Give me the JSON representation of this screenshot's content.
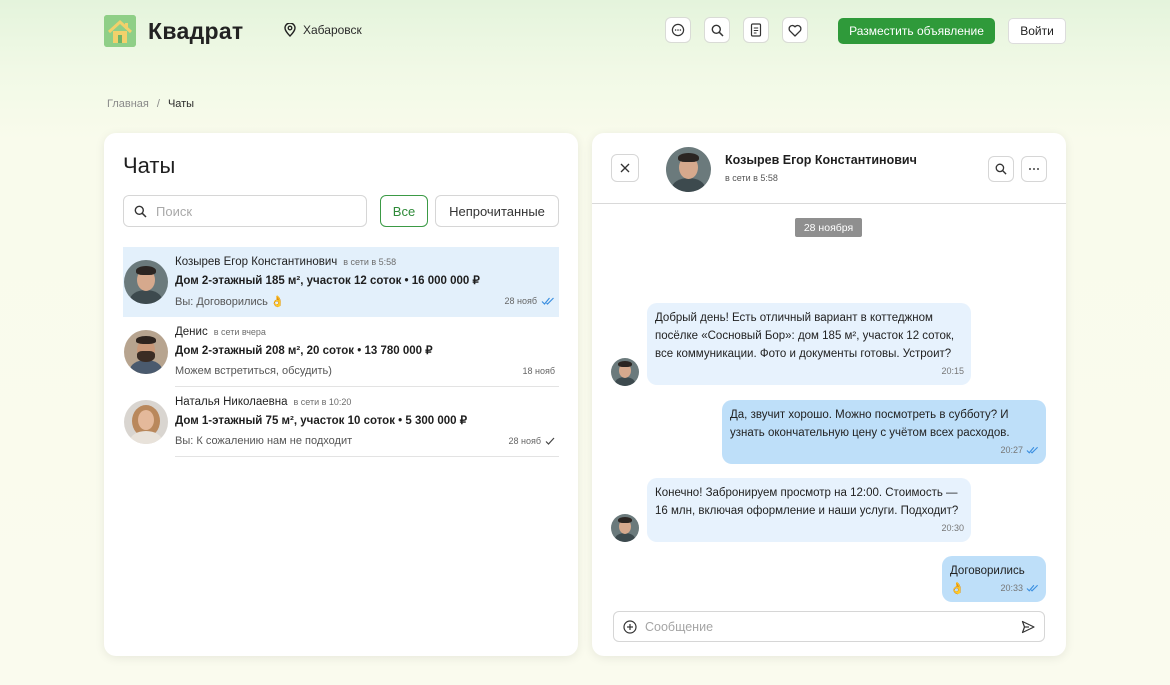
{
  "header": {
    "brand": "Квадрат",
    "city": "Хабаровск",
    "post_ad_label": "Разместить объявление",
    "login_label": "Войти"
  },
  "breadcrumb": {
    "home": "Главная",
    "separator": "/",
    "current": "Чаты"
  },
  "chats_panel": {
    "title": "Чаты",
    "search_placeholder": "Поиск",
    "filter_all": "Все",
    "filter_unread": "Непрочитанные",
    "items": [
      {
        "name": "Козырев Егор Константинович",
        "status": "в сети в 5:58",
        "ad": "Дом 2-этажный 185 м², участок 12 соток • 16 000 000 ₽",
        "last_message": "Вы: Договорились 👌",
        "date": "28 нояб",
        "read_state": "double-check-blue"
      },
      {
        "name": "Денис",
        "status": "в сети вчера",
        "ad": "Дом 2-этажный 208 м², 20 соток • 13 780 000 ₽",
        "last_message": "Можем встретиться, обсудить)",
        "date": "18 нояб",
        "read_state": "none"
      },
      {
        "name": "Наталья Николаевна",
        "status": "в сети в 10:20",
        "ad": "Дом 1-этажный 75 м², участок 10 соток • 5 300 000 ₽",
        "last_message": "Вы: К сожалению нам не подходит",
        "date": "28 нояб",
        "read_state": "single-check"
      }
    ]
  },
  "conversation": {
    "name": "Козырев Егор Константинович",
    "status": "в сети в 5:58",
    "date_divider": "28 ноября",
    "messages": [
      {
        "direction": "in",
        "lines": [
          "Добрый день! Есть отличный вариант в коттеджном",
          "посёлке «Сосновый Бор»: дом 185 м², участок 12 соток,",
          "все коммуникации. Фото и документы готовы. Устроит?"
        ],
        "time": "20:15"
      },
      {
        "direction": "out",
        "lines": [
          "Да, звучит хорошо. Можно посмотреть в субботу? И",
          "узнать окончательную цену с учётом всех расходов."
        ],
        "time": "20:27"
      },
      {
        "direction": "in",
        "lines": [
          "Конечно! Забронируем просмотр на 12:00. Стоимость —",
          "16 млн, включая оформление и наши услуги. Подходит?"
        ],
        "time": "20:30"
      },
      {
        "direction": "out",
        "lines": [
          "Договорились 👌"
        ],
        "time": "20:33"
      }
    ],
    "composer_placeholder": "Сообщение"
  },
  "colors": {
    "accent_green": "#2f9a3a",
    "active_chat": "#e3f0fb",
    "incoming_bubble": "#e7f2fd",
    "outgoing_bubble": "#bedff9",
    "read_check": "#3b8fe0"
  }
}
